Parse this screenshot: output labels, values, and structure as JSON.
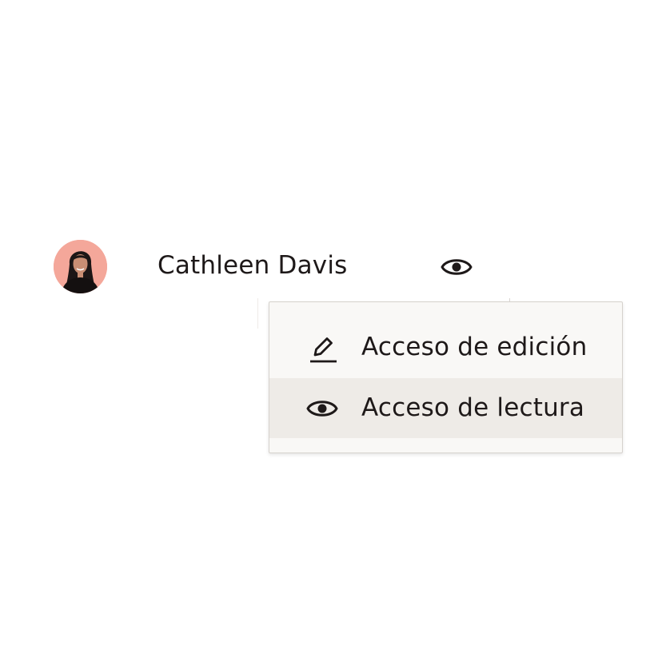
{
  "share_row": {
    "user_name": "Cathleen Davis",
    "avatar": {
      "background": "#f4a79a"
    },
    "current_access_icon": "eye-icon"
  },
  "access_menu": {
    "items": [
      {
        "label": "Acceso de edición",
        "icon": "pencil-icon",
        "selected": false
      },
      {
        "label": "Acceso de lectura",
        "icon": "eye-icon",
        "selected": true
      }
    ]
  },
  "colors": {
    "text": "#1e1919",
    "menu_background": "#f9f8f6",
    "menu_highlight": "#eeebe7",
    "menu_border": "#d6d2cd"
  }
}
